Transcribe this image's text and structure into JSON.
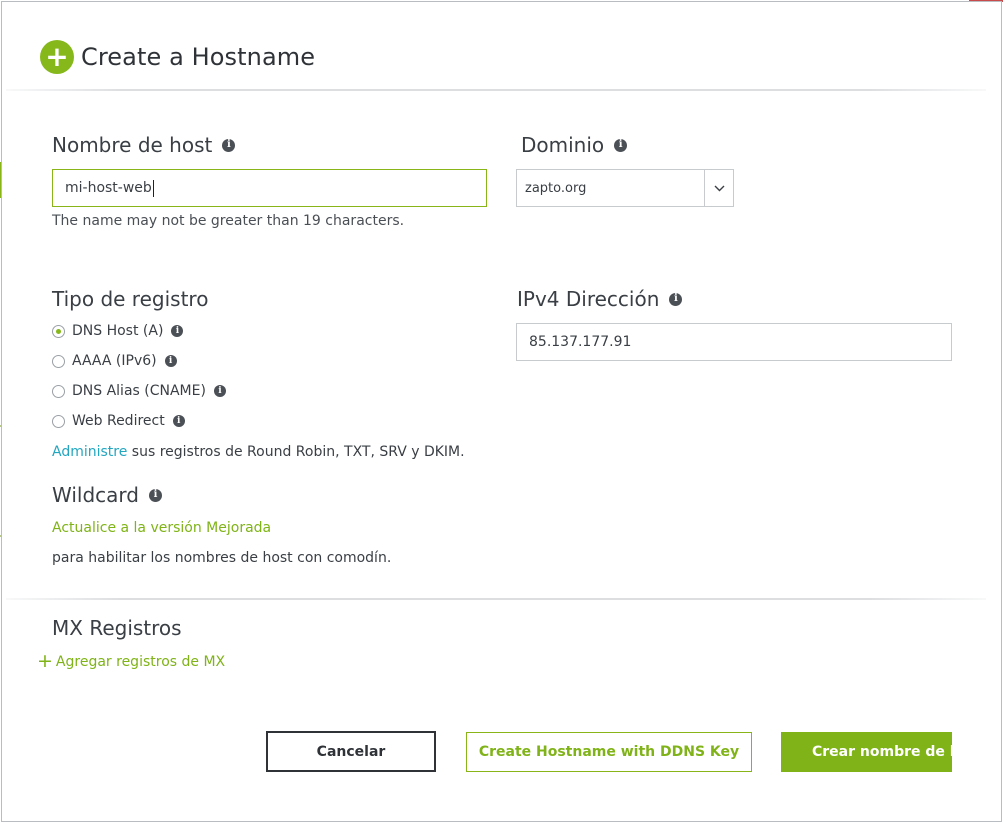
{
  "dialog": {
    "title": "Create a Hostname"
  },
  "hostname": {
    "label": "Nombre de host",
    "value": "mi-host-web",
    "help": "The name may not be greater than 19 characters."
  },
  "domain": {
    "label": "Dominio",
    "selected": "zapto.org"
  },
  "record_type": {
    "label": "Tipo de registro",
    "options": [
      {
        "label": "DNS Host (A)",
        "checked": true
      },
      {
        "label": "AAAA (IPv6)",
        "checked": false
      },
      {
        "label": "DNS Alias (CNAME)",
        "checked": false
      },
      {
        "label": "Web Redirect",
        "checked": false
      }
    ],
    "manage_link": "Administre",
    "manage_text": " sus registros de Round Robin, TXT, SRV y DKIM."
  },
  "ipv4": {
    "label": "IPv4 Dirección",
    "value": "85.137.177.91"
  },
  "wildcard": {
    "label": "Wildcard",
    "upgrade_link": "Actualice a la versión Mejorada",
    "description": "para habilitar los nombres de host con comodín."
  },
  "mx": {
    "label": "MX Registros",
    "add_link": "Agregar registros de MX"
  },
  "buttons": {
    "cancel": "Cancelar",
    "ddns": "Create Hostname with DDNS Key",
    "create": "Crear nombre de host"
  },
  "icons": {
    "info": "i",
    "plus": "+"
  },
  "colors": {
    "accent_green": "#7fb317",
    "link_teal": "#23a6c0",
    "text_dark": "#2f3338"
  }
}
